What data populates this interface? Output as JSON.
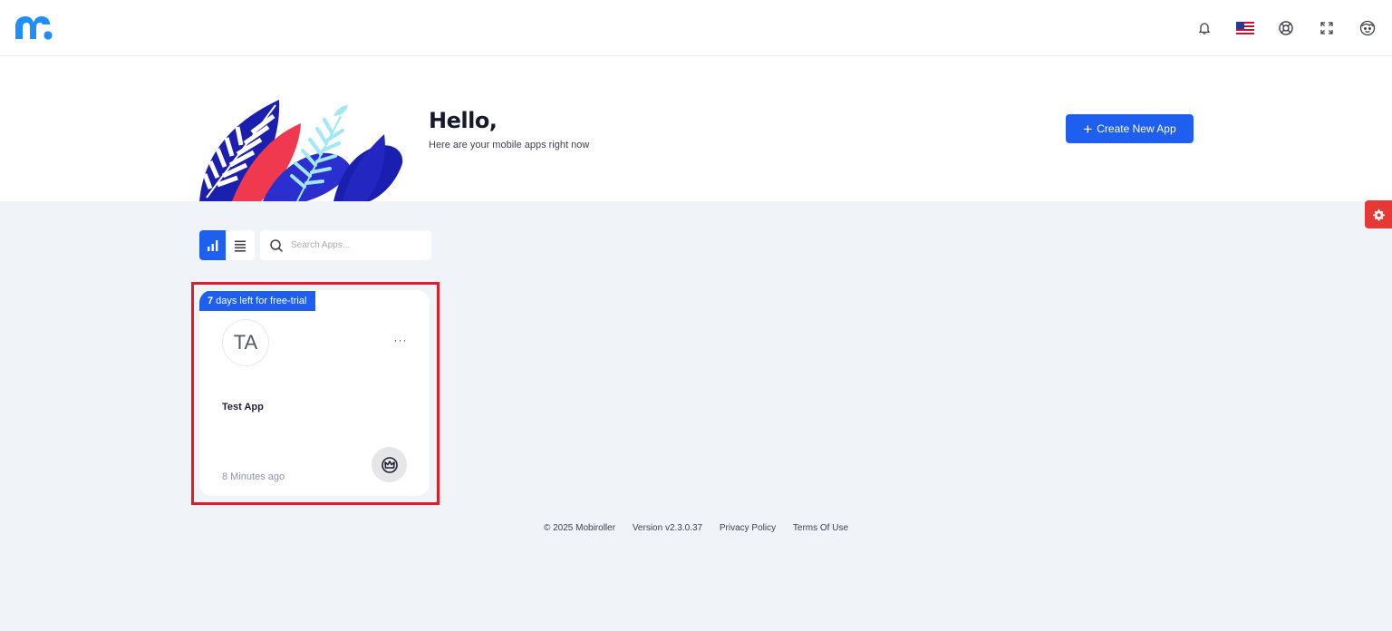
{
  "brand": {
    "logo_icon": "mobiroller-logo",
    "accent": "#1f5ff0",
    "alert": "#e53935"
  },
  "topbar": {
    "icons": [
      "bell-icon",
      "us-flag-icon",
      "lifebuoy-icon",
      "fullscreen-icon",
      "user-face-icon"
    ]
  },
  "hero": {
    "title": "Hello,",
    "subtitle": "Here are your mobile apps right now",
    "create_button": "Create New App"
  },
  "toolbar": {
    "search_placeholder": "Search Apps..."
  },
  "apps": [
    {
      "trial_days": "7",
      "trial_text": "days left for free-trial",
      "initials": "TA",
      "name": "Test App",
      "updated": "8 Minutes ago",
      "menu": "···"
    }
  ],
  "footer": {
    "copyright": "© 2025 Mobiroller",
    "version": "Version v2.3.0.37",
    "privacy": "Privacy Policy",
    "terms": "Terms Of Use"
  }
}
